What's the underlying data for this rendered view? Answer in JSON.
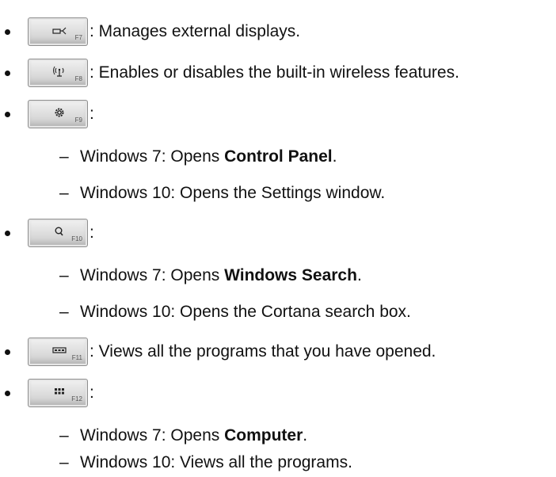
{
  "items": [
    {
      "key_label": "F7",
      "icon": "display-switch-icon",
      "text": ": Manages external displays."
    },
    {
      "key_label": "F8",
      "icon": "wireless-icon",
      "text": ": Enables or disables the built-in wireless features."
    },
    {
      "key_label": "F9",
      "icon": "settings-gear-icon",
      "text": ":",
      "subitems": [
        {
          "dash": "–",
          "prefix": "Windows 7: Opens ",
          "bold": "Control Panel",
          "suffix": "."
        },
        {
          "dash": "–",
          "prefix": "Windows 10: Opens the Settings window."
        }
      ]
    },
    {
      "key_label": "F10",
      "icon": "search-icon",
      "text": ":",
      "subitems": [
        {
          "dash": "–",
          "prefix": "Windows 7: Opens ",
          "bold": "Windows Search",
          "suffix": "."
        },
        {
          "dash": "–",
          "prefix": "Windows 10: Opens the Cortana search box."
        }
      ]
    },
    {
      "key_label": "F11",
      "icon": "task-view-icon",
      "text": ": Views all the programs that you have opened."
    },
    {
      "key_label": "F12",
      "icon": "apps-grid-icon",
      "text": ":",
      "subitems": [
        {
          "dash": "–",
          "prefix": "Windows 7: Opens ",
          "bold": "Computer",
          "suffix": "."
        },
        {
          "dash": "–",
          "prefix": "Windows 10: Views all the programs."
        }
      ]
    }
  ]
}
